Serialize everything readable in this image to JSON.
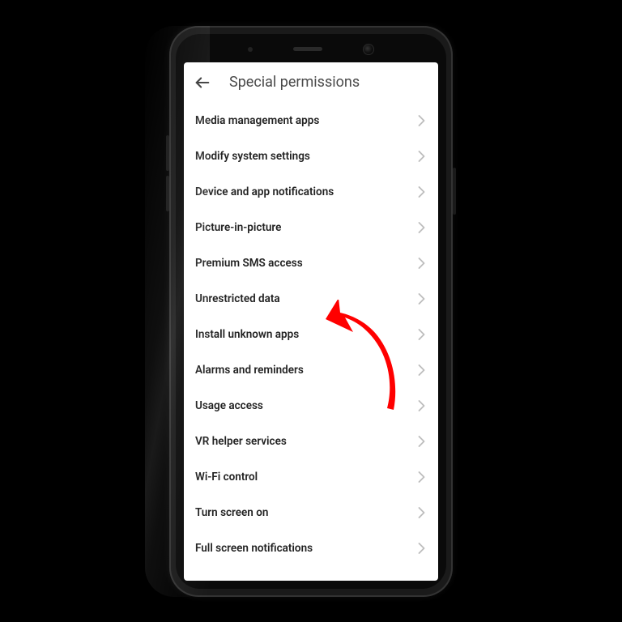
{
  "header": {
    "title": "Special permissions"
  },
  "items": [
    {
      "label": "Media management apps",
      "name": "item-media-management-apps"
    },
    {
      "label": "Modify system settings",
      "name": "item-modify-system-settings"
    },
    {
      "label": "Device and app notifications",
      "name": "item-device-app-notifications"
    },
    {
      "label": "Picture-in-picture",
      "name": "item-picture-in-picture"
    },
    {
      "label": "Premium SMS access",
      "name": "item-premium-sms-access"
    },
    {
      "label": "Unrestricted data",
      "name": "item-unrestricted-data"
    },
    {
      "label": "Install unknown apps",
      "name": "item-install-unknown-apps"
    },
    {
      "label": "Alarms and reminders",
      "name": "item-alarms-reminders"
    },
    {
      "label": "Usage access",
      "name": "item-usage-access"
    },
    {
      "label": "VR helper services",
      "name": "item-vr-helper-services"
    },
    {
      "label": "Wi-Fi control",
      "name": "item-wifi-control"
    },
    {
      "label": "Turn screen on",
      "name": "item-turn-screen-on"
    },
    {
      "label": "Full screen notifications",
      "name": "item-full-screen-notifications"
    }
  ],
  "annotation": {
    "arrow_color": "#ff0000",
    "points_to": "item-install-unknown-apps"
  }
}
